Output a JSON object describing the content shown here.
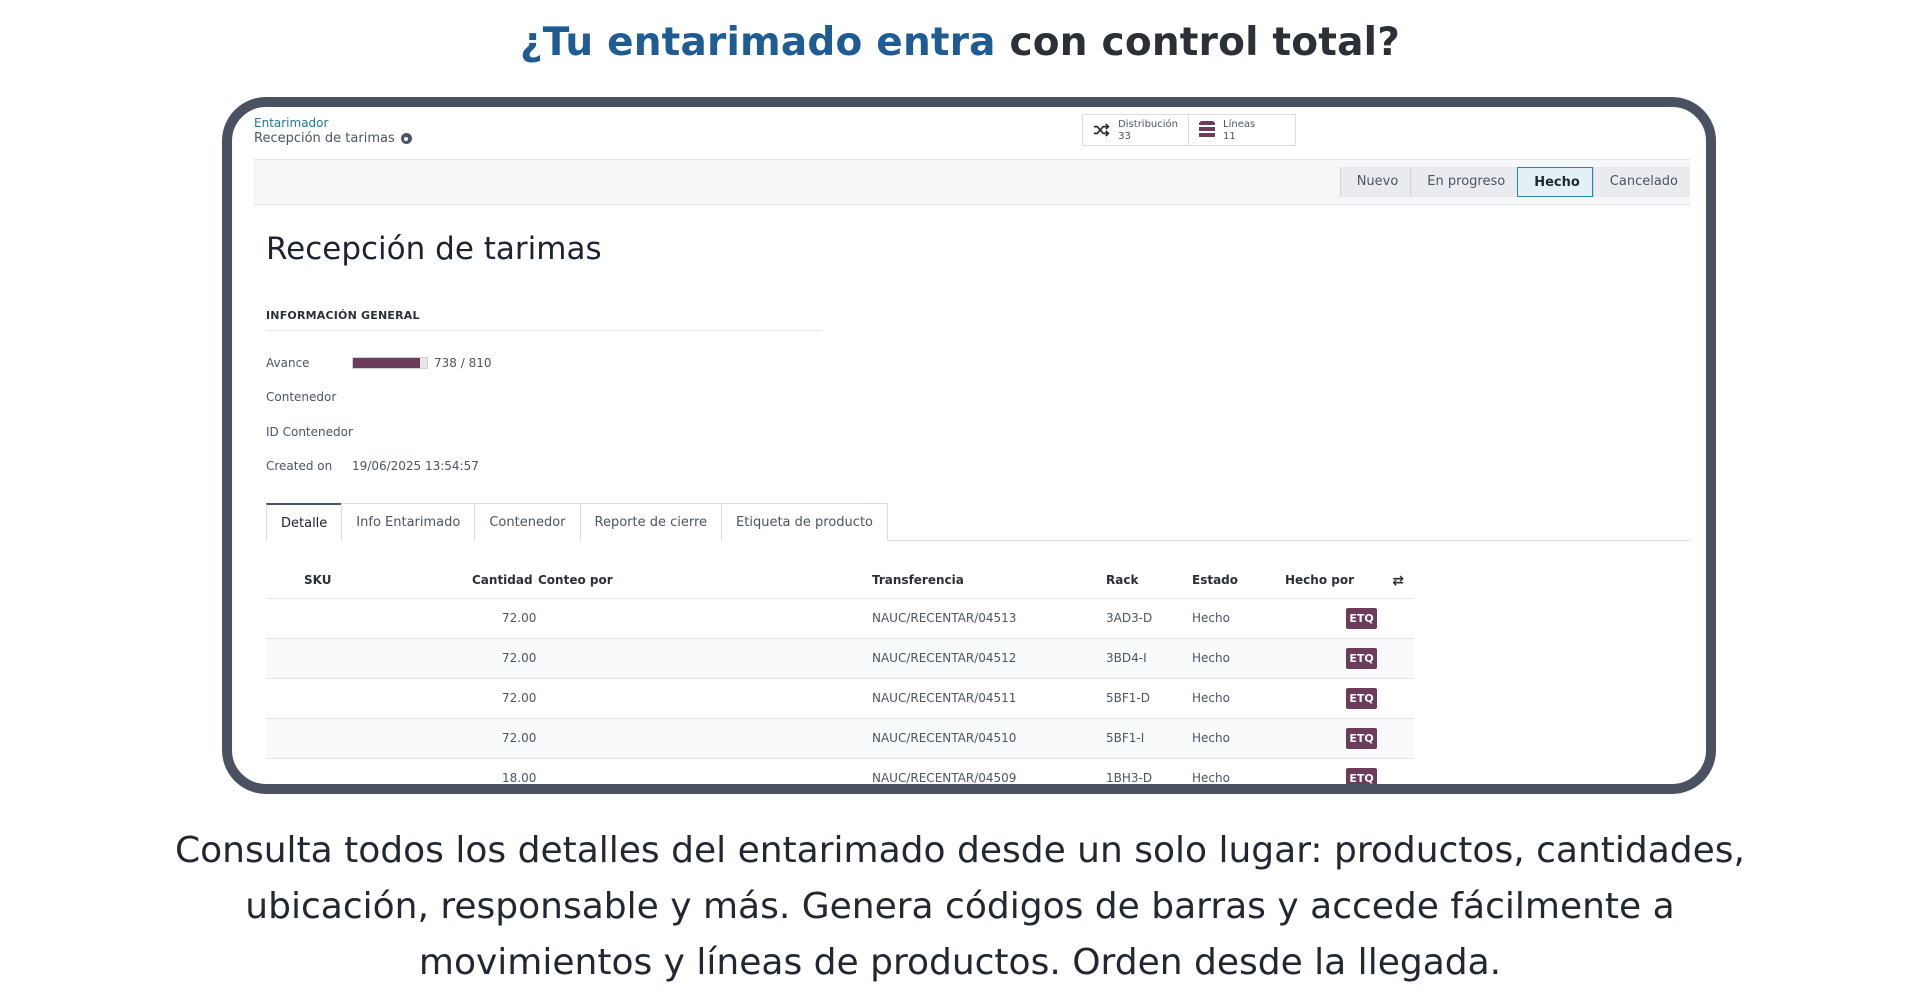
{
  "headline": {
    "accent": "¿Tu entarimado entra",
    "rest": " con control total?"
  },
  "breadcrumb": {
    "app": "Entarimador",
    "page": "Recepción de tarimas"
  },
  "smart_buttons": [
    {
      "label": "Distribución",
      "count": "33",
      "icon": "shuffle-icon"
    },
    {
      "label": "Líneas",
      "count": "11",
      "icon": "database-icon"
    }
  ],
  "status_steps": [
    "Nuevo",
    "En progreso",
    "Hecho",
    "Cancelado"
  ],
  "active_status": "Hecho",
  "form": {
    "title": "Recepción de tarimas",
    "section": "INFORMACIÓN GENERAL",
    "avance_label": "Avance",
    "avance_text": "738 / 810",
    "avance_fraction": 0.911,
    "contenedor_label": "Contenedor",
    "id_contenedor_label": "ID Contenedor",
    "created_label": "Created on",
    "created_value": "19/06/2025 13:54:57"
  },
  "tabs": [
    "Detalle",
    "Info Entarimado",
    "Contenedor",
    "Reporte de cierre",
    "Etiqueta de producto"
  ],
  "table": {
    "headers": {
      "sku": "SKU",
      "cantidad": "Cantidad",
      "conteo": "Conteo por",
      "transferencia": "Transferencia",
      "rack": "Rack",
      "estado": "Estado",
      "hecho_por": "Hecho por"
    },
    "rows": [
      {
        "cantidad": "72.00",
        "transferencia": "NAUC/RECENTAR/04513",
        "rack": "3AD3-D",
        "estado": "Hecho",
        "etq": "ETQ"
      },
      {
        "cantidad": "72.00",
        "transferencia": "NAUC/RECENTAR/04512",
        "rack": "3BD4-I",
        "estado": "Hecho",
        "etq": "ETQ"
      },
      {
        "cantidad": "72.00",
        "transferencia": "NAUC/RECENTAR/04511",
        "rack": "5BF1-D",
        "estado": "Hecho",
        "etq": "ETQ"
      },
      {
        "cantidad": "72.00",
        "transferencia": "NAUC/RECENTAR/04510",
        "rack": "5BF1-I",
        "estado": "Hecho",
        "etq": "ETQ"
      },
      {
        "cantidad": "18.00",
        "transferencia": "NAUC/RECENTAR/04509",
        "rack": "1BH3-D",
        "estado": "Hecho",
        "etq": "ETQ"
      }
    ]
  },
  "caption": "Consulta todos los detalles del entarimado desde un solo lugar: productos, cantidades, ubicación, responsable y más. Genera códigos de barras y accede fácilmente a movimientos y líneas de productos. Orden desde la llegada.",
  "colors": {
    "accent": "#1f5c93",
    "brand": "#6b3d5a",
    "frame": "#4a5160"
  }
}
